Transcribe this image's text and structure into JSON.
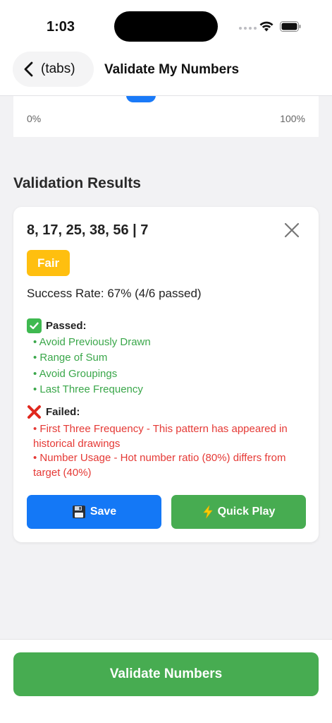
{
  "status_bar": {
    "time": "1:03"
  },
  "header": {
    "back_label": "(tabs)",
    "title": "Validate My Numbers"
  },
  "slider": {
    "min_label": "0%",
    "max_label": "100%"
  },
  "results": {
    "section_title": "Validation Results",
    "numbers": "8, 17, 25, 38, 56 | 7",
    "rating": "Fair",
    "success_rate": "Success Rate: 67% (4/6 passed)",
    "passed_title": "Passed:",
    "passed": [
      "• Avoid Previously Drawn",
      "• Range of Sum",
      "• Avoid Groupings",
      "• Last Three Frequency"
    ],
    "failed_title": "Failed:",
    "failed": [
      "• First Three Frequency - This pattern has appeared in historical drawings",
      "• Number Usage - Hot number ratio (80%) differs from target (40%)"
    ],
    "save_label": "Save",
    "quick_play_label": "Quick Play"
  },
  "footer": {
    "validate_label": "Validate Numbers"
  },
  "colors": {
    "accent_blue": "#1478f6",
    "green": "#47ac51",
    "badge_yellow": "#ffbf0f",
    "fail_red": "#e53935"
  }
}
